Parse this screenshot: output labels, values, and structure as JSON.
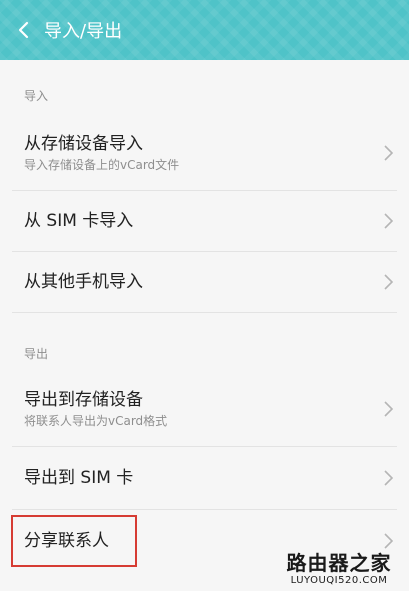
{
  "header": {
    "title": "导入/导出",
    "back_icon": "chevron-left-icon"
  },
  "import": {
    "section_label": "导入",
    "items": [
      {
        "title": "从存储设备导入",
        "subtitle": "导入存储设备上的vCard文件"
      },
      {
        "title": "从 SIM 卡导入"
      },
      {
        "title": "从其他手机导入"
      }
    ]
  },
  "export": {
    "section_label": "导出",
    "items": [
      {
        "title": "导出到存储设备",
        "subtitle": "将联系人导出为vCard格式"
      },
      {
        "title": "导出到 SIM 卡"
      },
      {
        "title": "分享联系人"
      }
    ]
  },
  "watermark": {
    "brand": "路由器之家",
    "site": "LUYOUQI520.COM"
  },
  "colors": {
    "header_bg": "#4fc3c8",
    "highlight_border": "#d63c33"
  }
}
